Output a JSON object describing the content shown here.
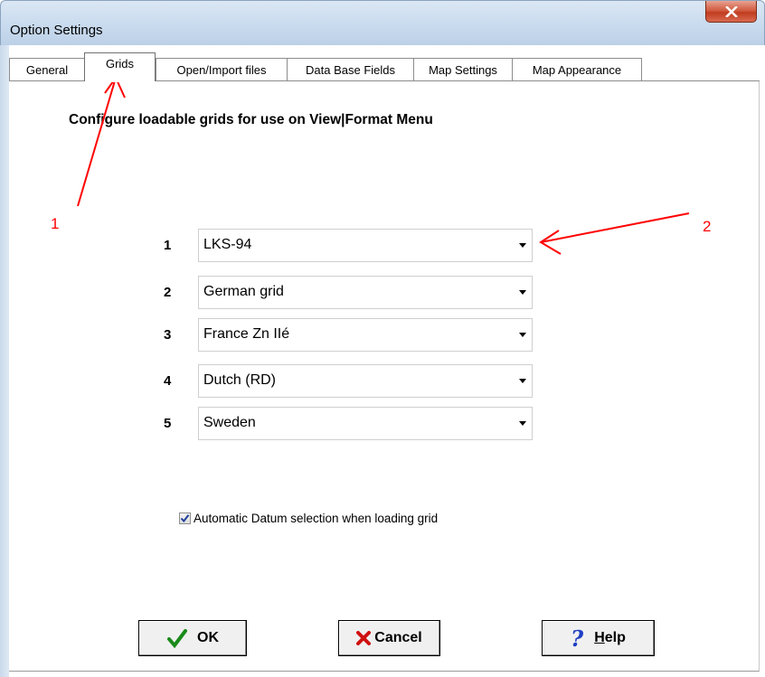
{
  "window": {
    "title": "Option Settings"
  },
  "tabs": [
    {
      "label": "General"
    },
    {
      "label": "Grids"
    },
    {
      "label": "Open/Import files"
    },
    {
      "label": "Data Base Fields"
    },
    {
      "label": "Map Settings"
    },
    {
      "label": "Map Appearance"
    }
  ],
  "active_tab": "Grids",
  "heading": "Configure loadable grids  for use on View|Format Menu",
  "grids": [
    {
      "num": "1",
      "value": "LKS-94"
    },
    {
      "num": "2",
      "value": "German grid"
    },
    {
      "num": "3",
      "value": "France Zn IIé"
    },
    {
      "num": "4",
      "value": "Dutch (RD)"
    },
    {
      "num": "5",
      "value": "Sweden"
    }
  ],
  "auto_datum": {
    "label": "Automatic Datum selection when loading grid",
    "checked": true
  },
  "buttons": {
    "ok": "OK",
    "cancel": "Cancel",
    "help": "Help"
  },
  "annotations": {
    "one": "1",
    "two": "2",
    "color": "#ff0000"
  }
}
